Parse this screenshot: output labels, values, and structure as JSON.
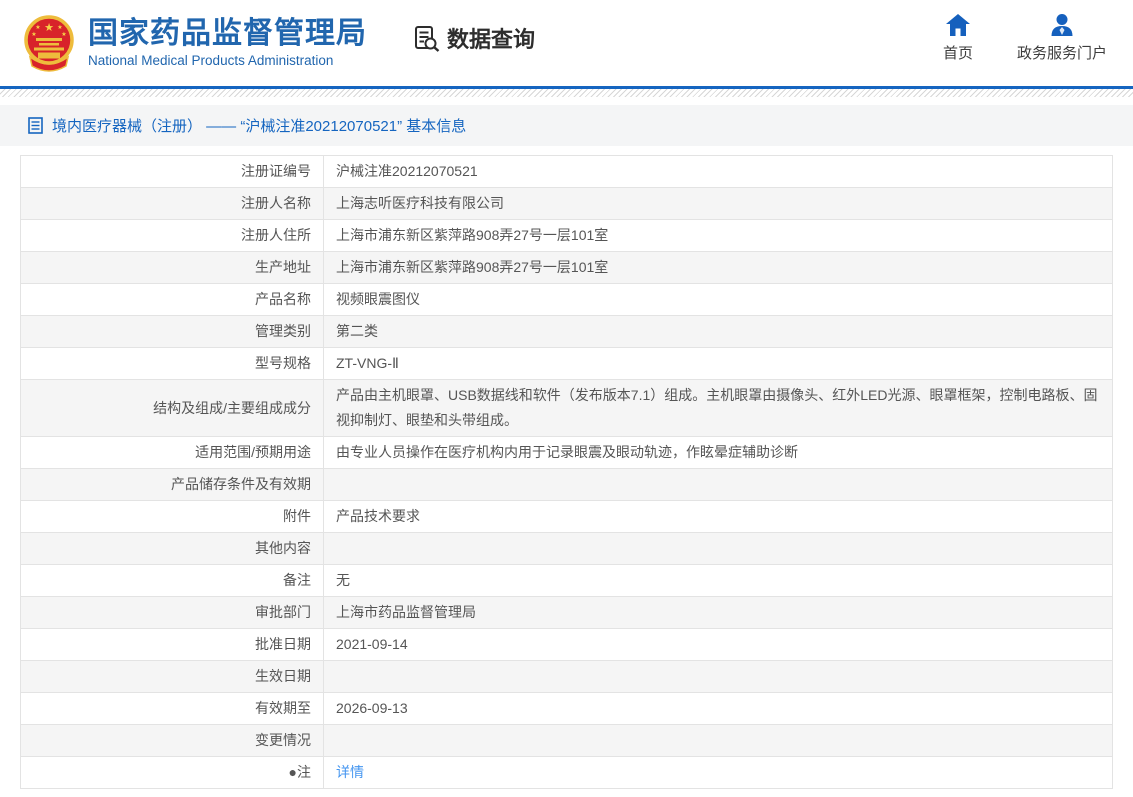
{
  "header": {
    "brand": {
      "title_cn": "国家药品监督管理局",
      "title_en": "National Medical Products Administration"
    },
    "data_query_label": "数据查询",
    "nav": [
      {
        "label": "首页",
        "icon": "home-icon"
      },
      {
        "label": "政务服务门户",
        "icon": "user-icon"
      }
    ]
  },
  "breadcrumb": {
    "icon": "form-icon",
    "text": "境内医疗器械（注册） —— “沪械注准20212070521” 基本信息"
  },
  "table": {
    "rows": [
      {
        "label": "注册证编号",
        "value": "沪械注准20212070521"
      },
      {
        "label": "注册人名称",
        "value": "上海志听医疗科技有限公司"
      },
      {
        "label": "注册人住所",
        "value": "上海市浦东新区紫萍路908弄27号一层101室"
      },
      {
        "label": "生产地址",
        "value": "上海市浦东新区紫萍路908弄27号一层101室"
      },
      {
        "label": "产品名称",
        "value": "视频眼震图仪"
      },
      {
        "label": "管理类别",
        "value": "第二类"
      },
      {
        "label": "型号规格",
        "value": "ZT-VNG-Ⅱ"
      },
      {
        "label": "结构及组成/主要组成成分",
        "value": "产品由主机眼罩、USB数据线和软件（发布版本7.1）组成。主机眼罩由摄像头、红外LED光源、眼罩框架，控制电路板、固视抑制灯、眼垫和头带组成。"
      },
      {
        "label": "适用范围/预期用途",
        "value": "由专业人员操作在医疗机构内用于记录眼震及眼动轨迹，作眩晕症辅助诊断"
      },
      {
        "label": "产品储存条件及有效期",
        "value": ""
      },
      {
        "label": "附件",
        "value": "产品技术要求"
      },
      {
        "label": "其他内容",
        "value": ""
      },
      {
        "label": "备注",
        "value": "无"
      },
      {
        "label": "审批部门",
        "value": "上海市药品监督管理局"
      },
      {
        "label": "批准日期",
        "value": "2021-09-14"
      },
      {
        "label": "生效日期",
        "value": ""
      },
      {
        "label": "有效期至",
        "value": "2026-09-13"
      },
      {
        "label": "变更情况",
        "value": ""
      },
      {
        "label": "●注",
        "value": "详情",
        "link": true
      }
    ]
  },
  "colors": {
    "brand_blue": "#2166ae",
    "accent_blue": "#1565c0",
    "icon_blue": "#1560bd",
    "link_blue": "#4596f0",
    "row_stripe": "#f5f5f5",
    "border": "#e3e3e3",
    "emblem_red": "#d8232a",
    "emblem_gold": "#eebc3c"
  }
}
